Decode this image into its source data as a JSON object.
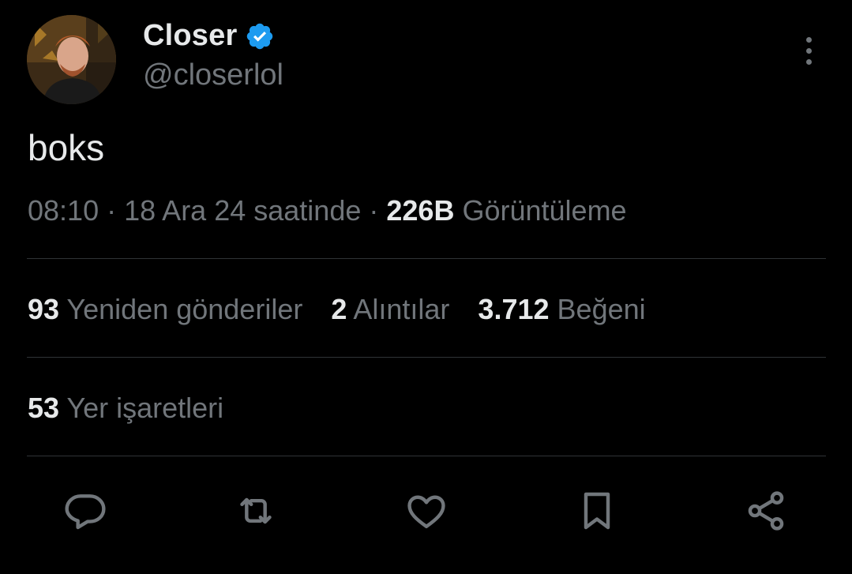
{
  "author": {
    "name": "Closer",
    "handle": "@closerlol",
    "verified_icon": "verified-badge-icon",
    "verified_color": "#1d9bf0"
  },
  "tweet": {
    "text": "boks",
    "time": "08:10",
    "separator": "·",
    "date": "18 Ara 24 saatinde",
    "views_count": "226B",
    "views_label": "Görüntüleme"
  },
  "stats": {
    "retweets_count": "93",
    "retweets_label": "Yeniden gönderiler",
    "quotes_count": "2",
    "quotes_label": "Alıntılar",
    "likes_count": "3.712",
    "likes_label": "Beğeni",
    "bookmarks_count": "53",
    "bookmarks_label": "Yer işaretleri"
  },
  "actions": [
    "reply-icon",
    "retweet-icon",
    "like-icon",
    "bookmark-icon",
    "share-icon"
  ],
  "colors": {
    "background": "#000000",
    "text_primary": "#e7e9ea",
    "text_secondary": "#71767b",
    "divider": "#2f3336"
  }
}
